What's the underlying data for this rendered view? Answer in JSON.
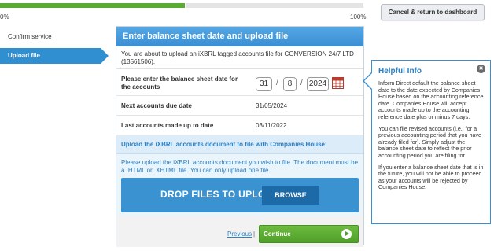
{
  "progress": {
    "start_label": "0%",
    "end_label": "100%",
    "value": 0.51
  },
  "header": {
    "cancel_label": "Cancel & return to dashboard"
  },
  "steps": [
    {
      "label": "Confirm service",
      "active": false
    },
    {
      "label": "Upload file",
      "active": true
    }
  ],
  "panel": {
    "title": "Enter balance sheet date and upload file",
    "intro": "You are about to upload an iXBRL tagged accounts file for CONVERSION 24/7 LTD (13561506).",
    "balance_label": "Please enter the balance sheet date for the accounts",
    "date": {
      "day": "31",
      "month": "8",
      "year": "2024"
    },
    "due_label": "Next accounts due date",
    "due_value": "31/05/2024",
    "last_label": "Last accounts made up to date",
    "last_value": "03/11/2022",
    "upload_title": "Upload the iXBRL accounts document to file with Companies House:",
    "upload_text": "Please upload the iXBRL accounts document you wish to file. The document must be a .HTML or .XHTML file. You can only upload one file.",
    "drop_label": "DROP FILES TO UPLOAD",
    "browse_label": "BROWSE",
    "previous_label": "Previous",
    "separator": "|",
    "continue_label": "Continue"
  },
  "info": {
    "title": "Helpful Info",
    "p1": "Inform Direct default the balance sheet date to the date expected by Companies House based on the accounting reference date. Companies House will accept accounts made up to the accounting reference date plus or minus 7 days.",
    "p2": "You can file revised accounts (i.e., for a previous accounting period that you have already filed for). Simply adjust the balance sheet date to reflect the prior accounting period you are filing for.",
    "p3": "If you enter a balance sheet date that is in the future, you will not be able to proceed as your accounts will be rejected by Companies House.",
    "close_glyph": "✕"
  },
  "colors": {
    "accent": "#3a8fd3",
    "progress": "#5aab32",
    "continue": "#5aab32",
    "calendar": "#c0392b"
  }
}
